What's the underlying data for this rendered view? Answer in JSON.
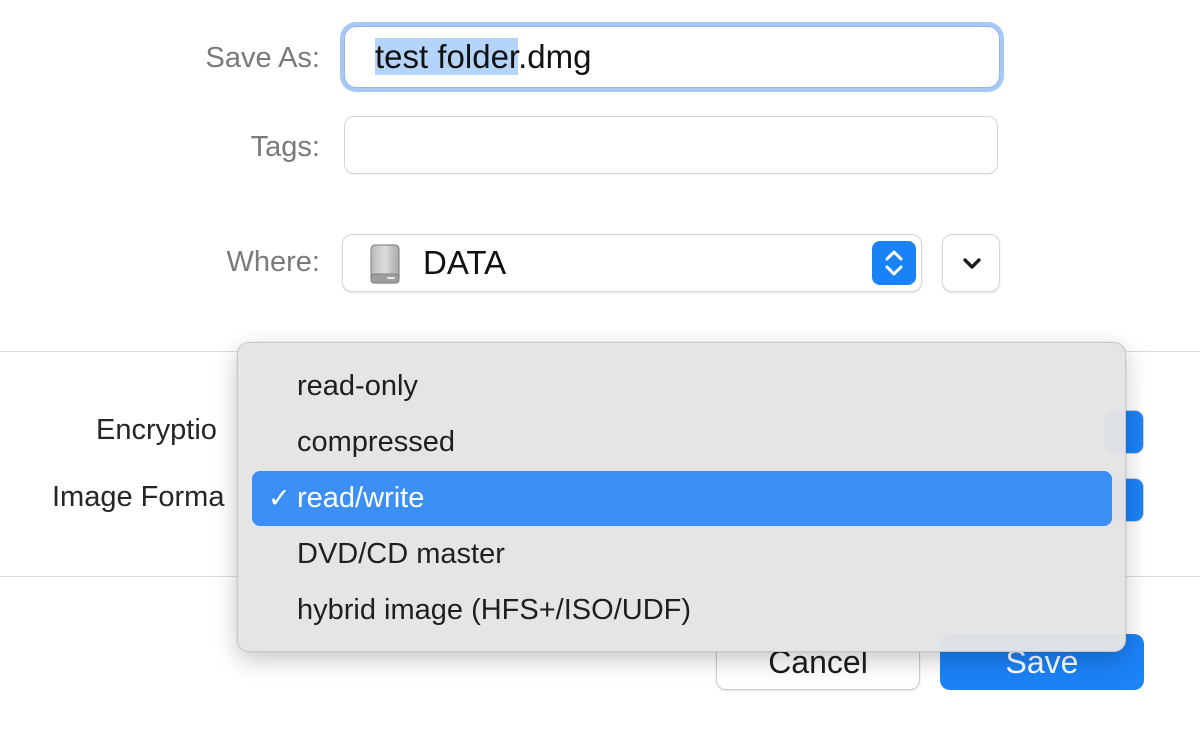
{
  "dialog": {
    "save_as_label": "Save As:",
    "save_as_value_selected": "test folder",
    "save_as_value_rest": ".dmg",
    "tags_label": "Tags:",
    "tags_value": "",
    "where_label": "Where:",
    "where_value": "DATA",
    "encryption_label": "Encryptio",
    "image_format_label": "Image Forma",
    "cancel_label": "Cancel",
    "save_label": "Save"
  },
  "format_menu": {
    "items": [
      {
        "label": "read-only",
        "checked": false
      },
      {
        "label": "compressed",
        "checked": false
      },
      {
        "label": "read/write",
        "checked": true
      },
      {
        "label": "DVD/CD master",
        "checked": false
      },
      {
        "label": "hybrid image (HFS+/ISO/UDF)",
        "checked": false
      }
    ],
    "check_glyph": "✓"
  },
  "icons": {
    "where_icon": "hard-drive-icon",
    "stepper_icon": "up-down-chevrons-icon",
    "expand_icon": "chevron-down-icon"
  },
  "colors": {
    "accent": "#1b82f7",
    "selection_highlight": "#b4d4fa",
    "menu_highlight": "#3b8ff5"
  }
}
